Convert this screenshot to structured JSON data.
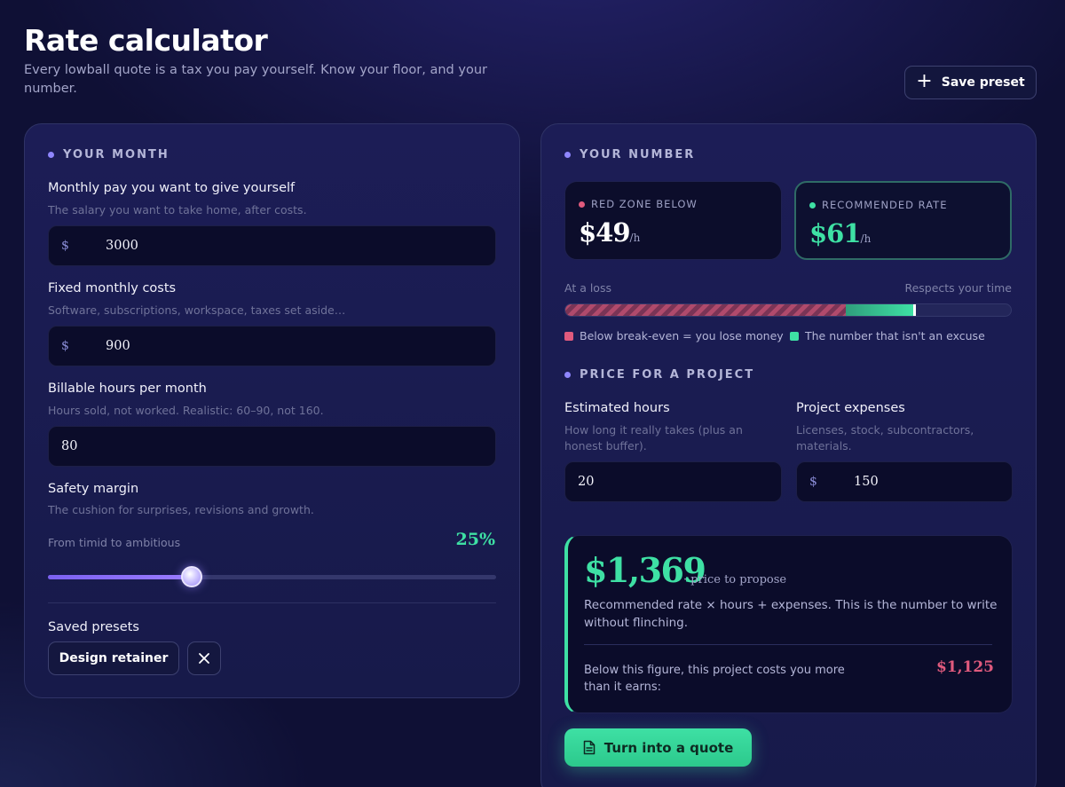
{
  "header": {
    "title": "Rate calculator",
    "subtitle": "Every lowball quote is a tax you pay yourself. Know your floor, and your number.",
    "save_preset_label": "Save preset"
  },
  "month": {
    "section_label": "YOUR MONTH",
    "pay": {
      "label": "Monthly pay you want to give yourself",
      "hint": "The salary you want to take home, after costs.",
      "currency": "$",
      "value": "3000"
    },
    "costs": {
      "label": "Fixed monthly costs",
      "hint": "Software, subscriptions, workspace, taxes set aside…",
      "currency": "$",
      "value": "900"
    },
    "hours": {
      "label": "Billable hours per month",
      "hint": "Hours sold, not worked. Realistic: 60–90, not 160.",
      "value": "80"
    },
    "margin": {
      "label": "Safety margin",
      "hint": "The cushion for surprises, revisions and growth.",
      "range_caption": "From timid to ambitious",
      "value_text": "25%",
      "slider_fraction": 0.32
    },
    "presets": {
      "label": "Saved presets",
      "items": [
        "Design retainer"
      ]
    }
  },
  "number": {
    "section_label": "YOUR NUMBER",
    "red_zone": {
      "label": "RED ZONE BELOW",
      "value": "$49",
      "unit": "/h"
    },
    "recommended": {
      "label": "RECOMMENDED RATE",
      "value": "$61",
      "unit": "/h"
    },
    "scale": {
      "left_caption": "At a loss",
      "right_caption": "Respects your time",
      "red_fraction": 0.63,
      "green_end_fraction": 0.78,
      "legend_red": "Below break-even = you lose money",
      "legend_green": "The number that isn't an excuse"
    }
  },
  "project": {
    "section_label": "PRICE FOR A PROJECT",
    "hours": {
      "label": "Estimated hours",
      "hint": "How long it really takes (plus an honest buffer).",
      "value": "20"
    },
    "expenses": {
      "label": "Project expenses",
      "hint": "Licenses, stock, subcontractors, materials.",
      "currency": "$",
      "value": "150"
    },
    "result": {
      "price": "$1,369",
      "suffix": "· price to propose",
      "description": "Recommended rate × hours + expenses. This is the number to write without flinching.",
      "below_text": "Below this figure, this project costs you more than it earns:",
      "below_value": "$1,125"
    },
    "quote_button_label": "Turn into a quote"
  },
  "colors": {
    "accent_green": "#3ee0a4",
    "accent_red": "#e05a7d",
    "accent_purple": "#8f86ff"
  }
}
